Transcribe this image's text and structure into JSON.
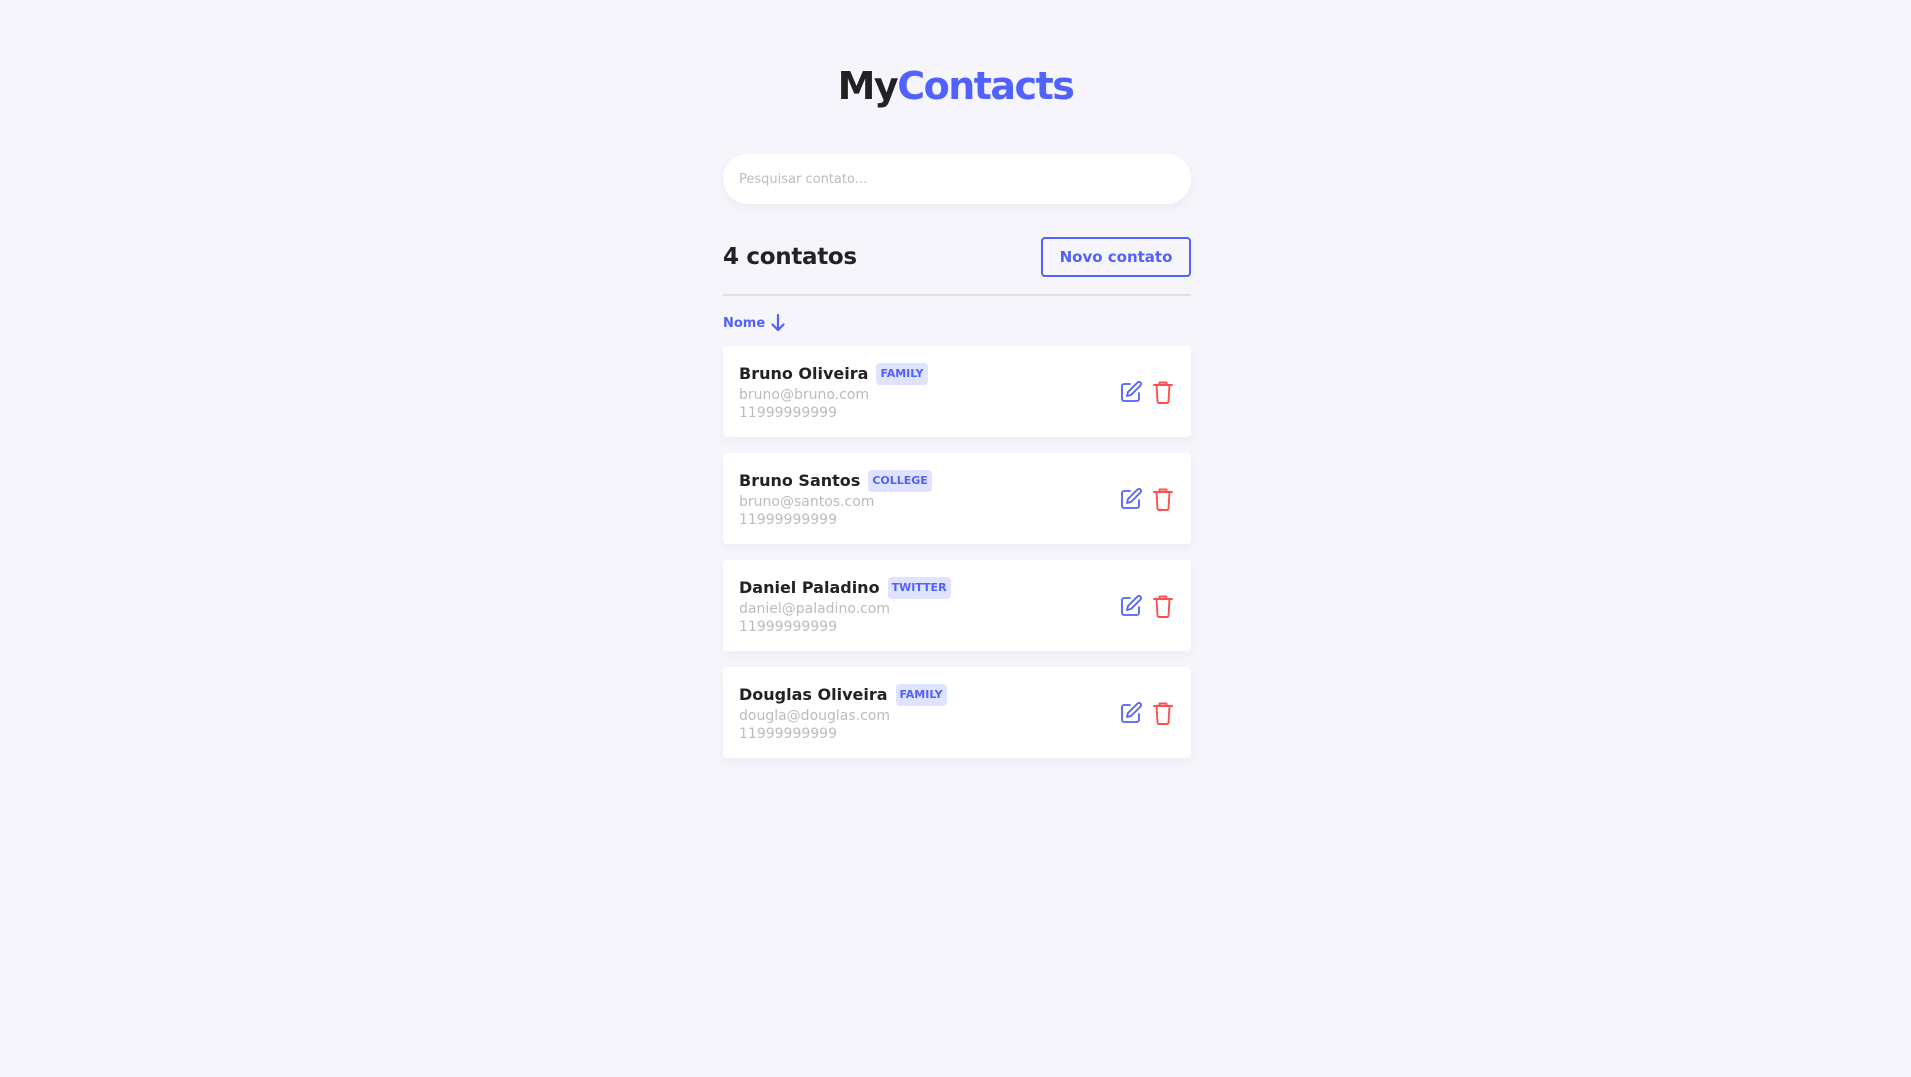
{
  "header": {
    "logo_part1": "My",
    "logo_part2": "Contacts"
  },
  "search": {
    "placeholder": "Pesquisar contato..."
  },
  "list_header": {
    "count_label": "4 contatos",
    "new_button_label": "Novo contato"
  },
  "sort": {
    "label": "Nome",
    "icon": "arrow-down-icon"
  },
  "contacts": [
    {
      "name": "Bruno Oliveira",
      "category": "FAMILY",
      "email": "bruno@bruno.com",
      "phone": "11999999999"
    },
    {
      "name": "Bruno Santos",
      "category": "COLLEGE",
      "email": "bruno@santos.com",
      "phone": "11999999999"
    },
    {
      "name": "Daniel Paladino",
      "category": "TWITTER",
      "email": "daniel@paladino.com",
      "phone": "11999999999"
    },
    {
      "name": "Douglas Oliveira",
      "category": "FAMILY",
      "email": "dougla@douglas.com",
      "phone": "11999999999"
    }
  ],
  "icons": {
    "edit": "edit-icon",
    "delete": "trash-icon"
  },
  "colors": {
    "background": "#f6f5fc",
    "primary": "#5061fc",
    "danger": "#fc5050",
    "text": "#222222",
    "muted": "#bcbcbc",
    "tag_bg": "#e0e3ff"
  }
}
